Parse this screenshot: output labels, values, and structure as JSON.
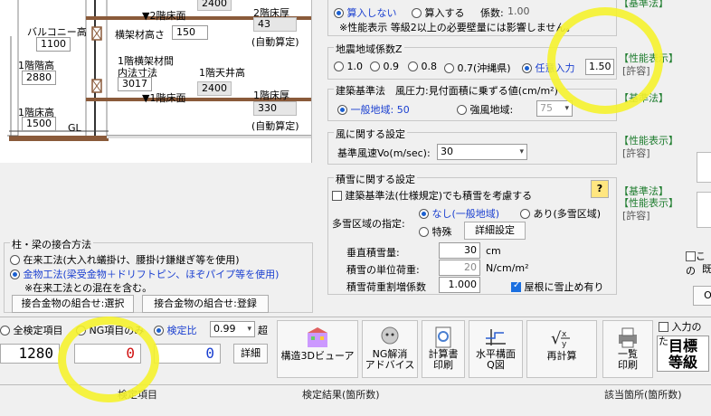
{
  "drawing": {
    "labels": {
      "floor2_ceiling_top": "2400",
      "floor2_floor_level": "▼2階床面",
      "floor2_thickness_label": "2階床厚",
      "floor2_thickness_value": "43",
      "auto_calc_1": "(自動算定)",
      "balcony_label": "バルコニー高",
      "balcony_value": "1100",
      "beam_label": "横架材高さ",
      "beam_value": "150",
      "floor1_height_label": "1階階高",
      "floor1_height_value": "2880",
      "floor1_beam_inner_label_1": "1階横架材間",
      "floor1_beam_inner_label_2": "内法寸法",
      "floor1_beam_inner_value": "3017",
      "floor1_ceiling_label": "1階天井高",
      "floor1_ceiling_value": "2400",
      "floor1_floor_level": "▼1階床面",
      "floor1_thickness_label": "1階床厚",
      "floor1_thickness_value": "330",
      "auto_calc_2": "(自動算定)",
      "floor1_floor_height_label": "1階床高",
      "floor1_floor_height_value": "1500",
      "gl": "GL"
    }
  },
  "joint": {
    "title": "柱・梁の接合方法",
    "opt1": "在来工法(大入れ蟻掛け、腰掛け鎌継ぎ等を使用)",
    "opt2": "金物工法(梁受金物＋ドリフトピン、ほぞパイプ等を使用)",
    "note": "※在来工法との混在を含む。",
    "btn_select": "接合金物の組合せ:選択",
    "btn_register": "接合金物の組合せ:登録"
  },
  "settings": {
    "top_partial": "【基準法】",
    "calc_off": "算入しない",
    "calc_on": "算入する",
    "coef_label": "係数:",
    "coef_value": "1.00",
    "perf_note": "※性能表示 等級2以上の必要壁量には影響しません。",
    "zone_title": "地震地域係数Z",
    "z_opts": [
      "1.0",
      "0.9",
      "0.8",
      "0.7(沖縄県)",
      "任意入力"
    ],
    "z_value": "1.50",
    "perf_label": "【性能表示】",
    "permit_label": "[許容]",
    "wind_area_title": "建築基準法　風圧力:見付面積に乗ずる値(cm/m²)",
    "wind_normal": "一般地域: 50",
    "wind_strong": "強風地域:",
    "wind_strong_value": "75",
    "base_label": "【基準法】",
    "wind_title": "風に関する設定",
    "wind_speed_label": "基準風速Vo(m/sec):",
    "wind_speed_value": "30",
    "snow_title": "積雪に関する設定",
    "snow_consider": "建築基準法(仕様規定)でも積雪を考慮する",
    "snow_zone_label": "多雪区域の指定:",
    "snow_none": "なし(一般地域)",
    "snow_yes": "あり(多雪区域)",
    "snow_special": "特殊",
    "snow_detail_btn": "詳細設定",
    "vertical_snow_label": "垂直積雪量:",
    "vertical_snow_value": "30",
    "vertical_snow_unit": "cm",
    "unit_load_label": "積雪の単位荷重:",
    "unit_load_value": "20",
    "unit_load_unit": "N/cm/m²",
    "reduction_label": "積雪荷重割増係数",
    "reduction_value": "1.000",
    "roof_stop": "屋根に雪止め有り",
    "help": "?"
  },
  "far_right": {
    "label_ko": "この",
    "label_ki": "既",
    "ok": "OK",
    "input_label": "入力のた"
  },
  "toolbar": {
    "all_items": "全検定項目",
    "ng_only": "NG項目のみ",
    "ratio": "検定比",
    "ratio_value": "0.99",
    "over": "超",
    "count_all": "1280",
    "count_ng": "0",
    "count_ratio": "0",
    "detail": "詳細",
    "btn_3d": "構造3Dビューア",
    "btn_ng_1": "NG解消",
    "btn_ng_2": "アドバイス",
    "btn_calc_1": "計算書",
    "btn_calc_2": "印刷",
    "btn_plan_1": "水平構面",
    "btn_plan_2": "Q図",
    "btn_recalc": "再計算",
    "btn_list_1": "一覧",
    "btn_list_2": "印刷",
    "target_1": "目標",
    "target_2": "等級"
  },
  "status": {
    "col1": "検定項目",
    "col2": "検定結果(箇所数)",
    "col3": "該当箇所(箇所数)"
  }
}
